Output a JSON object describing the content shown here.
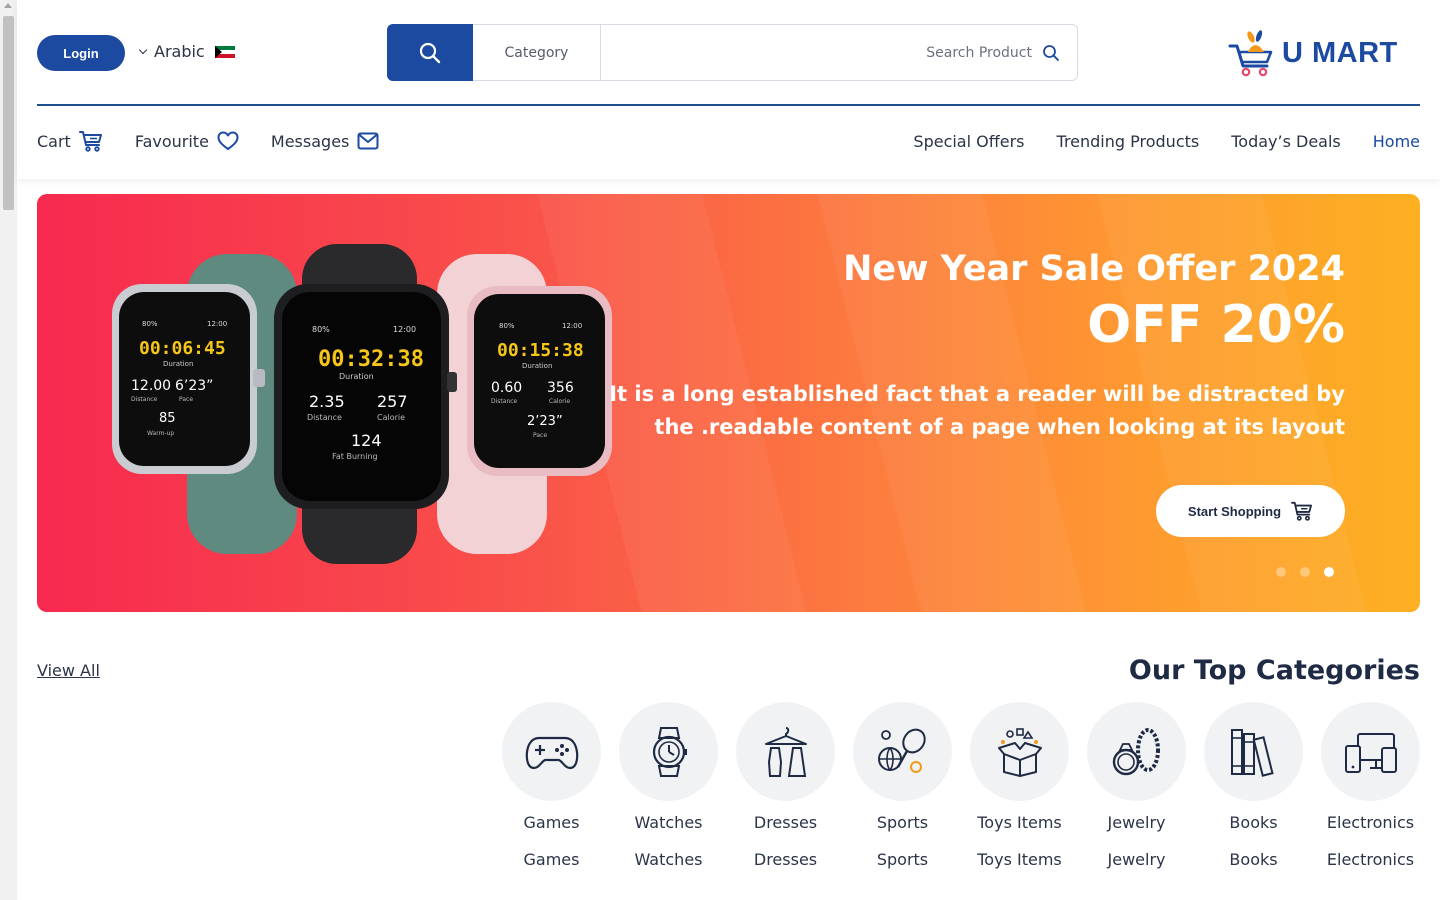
{
  "header": {
    "login_label": "Login",
    "language": "Arabic",
    "category_label": "Category",
    "search_placeholder": "Search Product",
    "logo_text": "U MART"
  },
  "nav": {
    "left": [
      {
        "label": "Cart",
        "icon": "cart-icon"
      },
      {
        "label": "Favourite",
        "icon": "heart-icon"
      },
      {
        "label": "Messages",
        "icon": "mail-icon"
      }
    ],
    "right": [
      {
        "label": "Special Offers"
      },
      {
        "label": "Trending Products"
      },
      {
        "label": "Today’s Deals"
      },
      {
        "label": "Home",
        "active": true
      }
    ]
  },
  "banner": {
    "title": "New Year Sale Offer 2024",
    "offer": "OFF 20%",
    "description": "It is a long established fact that a reader will be distracted by the .readable content of a page when looking at its layout",
    "button_label": "Start Shopping",
    "slides_count": 3,
    "active_slide": 3,
    "watches": [
      {
        "time": "00:06:45",
        "sub": "Duration",
        "a": "12.00",
        "a_label": "Distance",
        "b": "6’23”",
        "b_label": "Pace",
        "c": "85",
        "c_label": "Warm-up",
        "battery": "80%",
        "clock": "12:00",
        "band": "#5f8a80"
      },
      {
        "time": "00:32:38",
        "sub": "Duration",
        "a": "2.35",
        "a_label": "Distance",
        "b": "257",
        "b_label": "Calorie",
        "c": "124",
        "c_label": "Fat Burning",
        "battery": "80%",
        "clock": "12:00",
        "band": "#2a2a2c"
      },
      {
        "time": "00:15:38",
        "sub": "Duration",
        "a": "0.60",
        "a_label": "Distance",
        "b": "356",
        "b_label": "Calorie",
        "c": "2’23”",
        "c_label": "Pace",
        "battery": "80%",
        "clock": "12:00",
        "band": "#f3d2d6"
      }
    ]
  },
  "categories": {
    "view_all": "View All",
    "title": "Our Top Categories",
    "items": [
      {
        "label": "Games",
        "icon": "gamepad-icon"
      },
      {
        "label": "Watches",
        "icon": "watch-icon"
      },
      {
        "label": "Dresses",
        "icon": "dress-icon"
      },
      {
        "label": "Sports",
        "icon": "sports-icon"
      },
      {
        "label": "Toys Items",
        "icon": "toys-icon"
      },
      {
        "label": "Jewelry",
        "icon": "jewelry-icon"
      },
      {
        "label": "Books",
        "icon": "books-icon"
      },
      {
        "label": "Electronics",
        "icon": "electronics-icon"
      }
    ]
  },
  "colors": {
    "primary": "#1b4aa0",
    "banner_start": "#f7294f",
    "banner_end": "#fdb022"
  }
}
